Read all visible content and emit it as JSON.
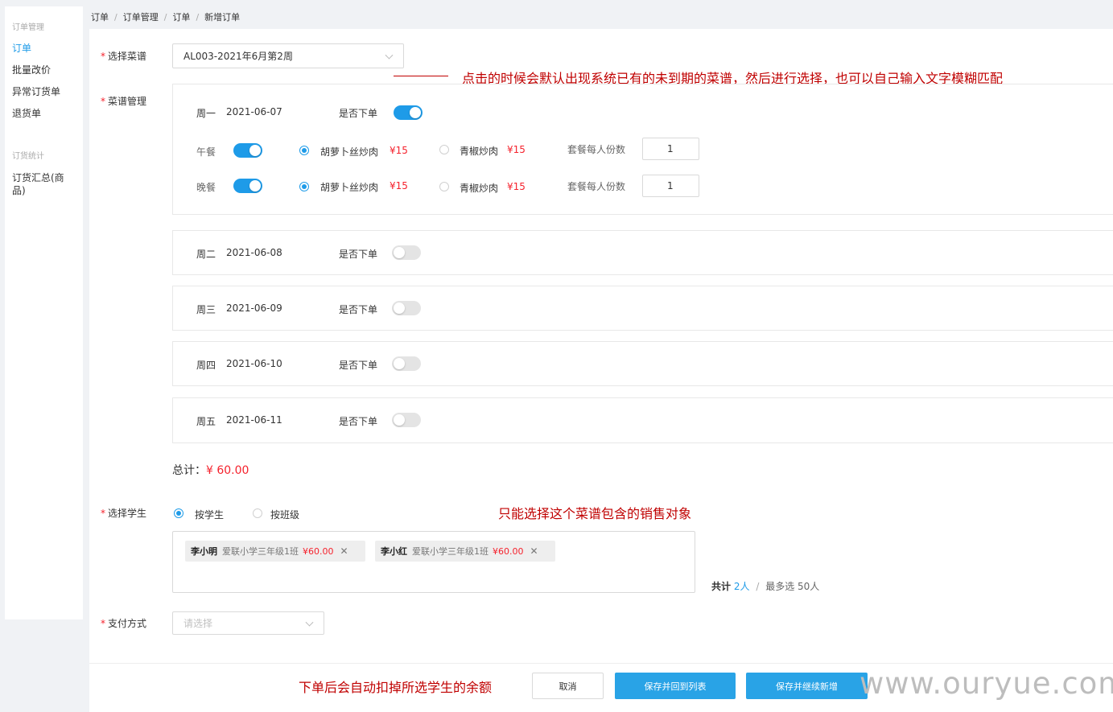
{
  "sidebar": {
    "group1": "订单管理",
    "items1": [
      "订单",
      "批量改价",
      "异常订货单",
      "退货单"
    ],
    "group2": "订货统计",
    "items2": [
      "订货汇总(商品)"
    ]
  },
  "breadcrumb": [
    "订单",
    "订单管理",
    "订单",
    "新增订单"
  ],
  "form": {
    "menu_label": "选择菜谱",
    "menu_value": "AL003-2021年6月第2周",
    "menu_mgmt_label": "菜谱管理",
    "student_label": "选择学生",
    "payment_label": "支付方式",
    "payment_placeholder": "请选择"
  },
  "days": [
    {
      "weekday": "周一",
      "date": "2021-06-07",
      "order_label": "是否下单",
      "order_on": true
    },
    {
      "weekday": "周二",
      "date": "2021-06-08",
      "order_label": "是否下单",
      "order_on": false
    },
    {
      "weekday": "周三",
      "date": "2021-06-09",
      "order_label": "是否下单",
      "order_on": false
    },
    {
      "weekday": "周四",
      "date": "2021-06-10",
      "order_label": "是否下单",
      "order_on": false
    },
    {
      "weekday": "周五",
      "date": "2021-06-11",
      "order_label": "是否下单",
      "order_on": false
    }
  ],
  "meals": [
    {
      "name": "午餐",
      "on": true,
      "dish1": "胡萝卜丝炒肉",
      "price1": "¥15",
      "dish1_selected": true,
      "dish2": "青椒炒肉",
      "price2": "¥15",
      "dish2_selected": false,
      "servings_label": "套餐每人份数",
      "servings": "1"
    },
    {
      "name": "晚餐",
      "on": true,
      "dish1": "胡萝卜丝炒肉",
      "price1": "¥15",
      "dish1_selected": true,
      "dish2": "青椒炒肉",
      "price2": "¥15",
      "dish2_selected": false,
      "servings_label": "套餐每人份数",
      "servings": "1"
    }
  ],
  "total": {
    "label": "总计：",
    "value": "¥ 60.00"
  },
  "student_mode": {
    "opt1": "按学生",
    "opt2": "按班级",
    "selected": "按学生"
  },
  "students": [
    {
      "name": "李小明",
      "school": "爱联小学三年级1班",
      "price": "¥60.00"
    },
    {
      "name": "李小红",
      "school": "爱联小学三年级1班",
      "price": "¥60.00"
    }
  ],
  "count": {
    "prefix": "共计",
    "value": "2人",
    "sep": "/",
    "max": "最多选 50人"
  },
  "buttons": {
    "cancel": "取消",
    "save_return": "保存并回到列表",
    "save_continue": "保存并继续新增"
  },
  "annotations": {
    "a1": "点击的时候会默认出现系统已有的未到期的菜谱，然后进行选择，也可以自己输入文字模糊匹配",
    "a2": "只能选择这个菜谱包含的销售对象",
    "a3": "下单后会自动扣掉所选学生的余额"
  },
  "watermark": "www.ouryue.com",
  "colors": {
    "accent": "#1e9be8",
    "price": "#f5222d",
    "annotation": "#c00000"
  }
}
